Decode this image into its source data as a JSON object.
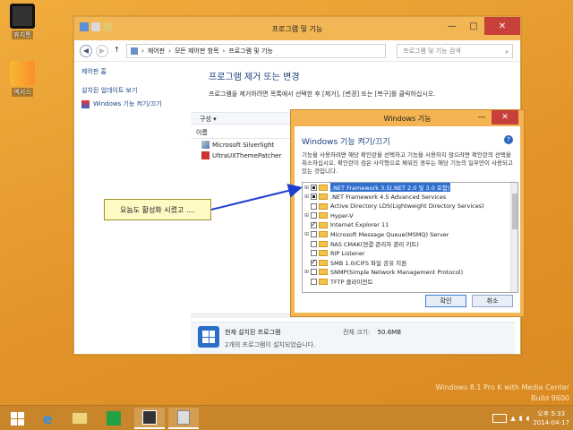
{
  "desktop": {
    "icons": [
      {
        "label": "휴지통"
      },
      {
        "label": "엑서스"
      }
    ],
    "watermark": [
      "Windows 8.1 Pro K with Media Center",
      "Build 9600",
      "2014-04-17"
    ]
  },
  "control_panel": {
    "title": "프로그램 및 기능",
    "breadcrumb": [
      "제어판",
      "모든 제어판 항목",
      "프로그램 및 기능"
    ],
    "search_placeholder": "프로그램 및 기능 검색",
    "left_links": [
      "제어판 홈",
      "설치된 업데이트 보기",
      "Windows 기능 켜기/끄기"
    ],
    "main_title": "프로그램 제거 또는 변경",
    "main_desc": "프로그램을 제거하려면 목록에서 선택한 후 [제거], [변경] 또는 [복구]를 클릭하십시오.",
    "toolbar_label": "구성 ▾",
    "column_name": "이름",
    "programs": [
      "Microsoft Silverlight",
      "UltraUXThemePatcher"
    ],
    "footer": {
      "title": "현재 설치된 프로그램",
      "size_label": "전체 크기:",
      "size_value": "50.6MB",
      "count_text": "2개의 프로그램이 설치되었습니다."
    }
  },
  "features_dialog": {
    "title": "Windows 기능",
    "heading": "Windows 기능 켜기/끄기",
    "description": "기능을 사용하려면 해당 확인란을 선택하고 기능을 사용하지 않으려면 확인란의 선택을 취소하십시오. 확인란이 검은 사각형으로 채워진 경우는 해당 기능의 일부만이 사용되고 있는 것입니다.",
    "items": [
      {
        "label": ".NET Framework 3.5(.NET 2.0 및 3.0 포함)",
        "expand": "⊞",
        "state": "filled",
        "selected": true
      },
      {
        "label": ".NET Framework 4.5 Advanced Services",
        "expand": "⊞",
        "state": "filled",
        "selected": false
      },
      {
        "label": "Active Directory LDS(Lightweight Directory Services)",
        "expand": "",
        "state": "empty",
        "selected": false
      },
      {
        "label": "Hyper-V",
        "expand": "⊞",
        "state": "empty",
        "selected": false
      },
      {
        "label": "Internet Explorer 11",
        "expand": "",
        "state": "checked",
        "selected": false
      },
      {
        "label": "Microsoft Message Queue(MSMQ) Server",
        "expand": "⊞",
        "state": "empty",
        "selected": false
      },
      {
        "label": "RAS CMAK(연결 관리자 관리 키트)",
        "expand": "",
        "state": "empty",
        "selected": false
      },
      {
        "label": "RIP Listener",
        "expand": "",
        "state": "empty",
        "selected": false
      },
      {
        "label": "SMB 1.0/CIFS 파일 공유 지원",
        "expand": "",
        "state": "checked",
        "selected": false
      },
      {
        "label": "SNMP(Simple Network Management Protocol)",
        "expand": "⊞",
        "state": "empty",
        "selected": false
      },
      {
        "label": "TFTP 클라이언트",
        "expand": "",
        "state": "empty",
        "selected": false
      }
    ],
    "ok_label": "확인",
    "cancel_label": "취소"
  },
  "callout": {
    "text": "요놈도 활성화 시켰고 ...."
  },
  "taskbar": {
    "clock_time": "오후 5:33",
    "clock_date": "2014-04-17"
  },
  "colors": {
    "accent": "#f3b451",
    "desktop": "#e79a2e",
    "taskbar": "#c9852a"
  }
}
